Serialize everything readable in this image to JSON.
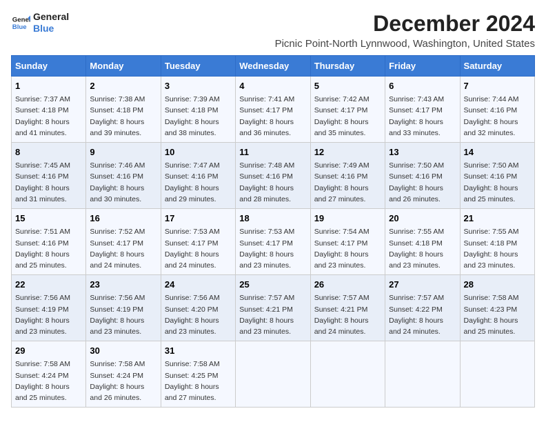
{
  "logo": {
    "line1": "General",
    "line2": "Blue"
  },
  "title": "December 2024",
  "subtitle": "Picnic Point-North Lynnwood, Washington, United States",
  "days_of_week": [
    "Sunday",
    "Monday",
    "Tuesday",
    "Wednesday",
    "Thursday",
    "Friday",
    "Saturday"
  ],
  "weeks": [
    [
      {
        "day": "1",
        "sunrise": "7:37 AM",
        "sunset": "4:18 PM",
        "daylight": "8 hours and 41 minutes."
      },
      {
        "day": "2",
        "sunrise": "7:38 AM",
        "sunset": "4:18 PM",
        "daylight": "8 hours and 39 minutes."
      },
      {
        "day": "3",
        "sunrise": "7:39 AM",
        "sunset": "4:18 PM",
        "daylight": "8 hours and 38 minutes."
      },
      {
        "day": "4",
        "sunrise": "7:41 AM",
        "sunset": "4:17 PM",
        "daylight": "8 hours and 36 minutes."
      },
      {
        "day": "5",
        "sunrise": "7:42 AM",
        "sunset": "4:17 PM",
        "daylight": "8 hours and 35 minutes."
      },
      {
        "day": "6",
        "sunrise": "7:43 AM",
        "sunset": "4:17 PM",
        "daylight": "8 hours and 33 minutes."
      },
      {
        "day": "7",
        "sunrise": "7:44 AM",
        "sunset": "4:16 PM",
        "daylight": "8 hours and 32 minutes."
      }
    ],
    [
      {
        "day": "8",
        "sunrise": "7:45 AM",
        "sunset": "4:16 PM",
        "daylight": "8 hours and 31 minutes."
      },
      {
        "day": "9",
        "sunrise": "7:46 AM",
        "sunset": "4:16 PM",
        "daylight": "8 hours and 30 minutes."
      },
      {
        "day": "10",
        "sunrise": "7:47 AM",
        "sunset": "4:16 PM",
        "daylight": "8 hours and 29 minutes."
      },
      {
        "day": "11",
        "sunrise": "7:48 AM",
        "sunset": "4:16 PM",
        "daylight": "8 hours and 28 minutes."
      },
      {
        "day": "12",
        "sunrise": "7:49 AM",
        "sunset": "4:16 PM",
        "daylight": "8 hours and 27 minutes."
      },
      {
        "day": "13",
        "sunrise": "7:50 AM",
        "sunset": "4:16 PM",
        "daylight": "8 hours and 26 minutes."
      },
      {
        "day": "14",
        "sunrise": "7:50 AM",
        "sunset": "4:16 PM",
        "daylight": "8 hours and 25 minutes."
      }
    ],
    [
      {
        "day": "15",
        "sunrise": "7:51 AM",
        "sunset": "4:16 PM",
        "daylight": "8 hours and 25 minutes."
      },
      {
        "day": "16",
        "sunrise": "7:52 AM",
        "sunset": "4:17 PM",
        "daylight": "8 hours and 24 minutes."
      },
      {
        "day": "17",
        "sunrise": "7:53 AM",
        "sunset": "4:17 PM",
        "daylight": "8 hours and 24 minutes."
      },
      {
        "day": "18",
        "sunrise": "7:53 AM",
        "sunset": "4:17 PM",
        "daylight": "8 hours and 23 minutes."
      },
      {
        "day": "19",
        "sunrise": "7:54 AM",
        "sunset": "4:17 PM",
        "daylight": "8 hours and 23 minutes."
      },
      {
        "day": "20",
        "sunrise": "7:55 AM",
        "sunset": "4:18 PM",
        "daylight": "8 hours and 23 minutes."
      },
      {
        "day": "21",
        "sunrise": "7:55 AM",
        "sunset": "4:18 PM",
        "daylight": "8 hours and 23 minutes."
      }
    ],
    [
      {
        "day": "22",
        "sunrise": "7:56 AM",
        "sunset": "4:19 PM",
        "daylight": "8 hours and 23 minutes."
      },
      {
        "day": "23",
        "sunrise": "7:56 AM",
        "sunset": "4:19 PM",
        "daylight": "8 hours and 23 minutes."
      },
      {
        "day": "24",
        "sunrise": "7:56 AM",
        "sunset": "4:20 PM",
        "daylight": "8 hours and 23 minutes."
      },
      {
        "day": "25",
        "sunrise": "7:57 AM",
        "sunset": "4:21 PM",
        "daylight": "8 hours and 23 minutes."
      },
      {
        "day": "26",
        "sunrise": "7:57 AM",
        "sunset": "4:21 PM",
        "daylight": "8 hours and 24 minutes."
      },
      {
        "day": "27",
        "sunrise": "7:57 AM",
        "sunset": "4:22 PM",
        "daylight": "8 hours and 24 minutes."
      },
      {
        "day": "28",
        "sunrise": "7:58 AM",
        "sunset": "4:23 PM",
        "daylight": "8 hours and 25 minutes."
      }
    ],
    [
      {
        "day": "29",
        "sunrise": "7:58 AM",
        "sunset": "4:24 PM",
        "daylight": "8 hours and 25 minutes."
      },
      {
        "day": "30",
        "sunrise": "7:58 AM",
        "sunset": "4:24 PM",
        "daylight": "8 hours and 26 minutes."
      },
      {
        "day": "31",
        "sunrise": "7:58 AM",
        "sunset": "4:25 PM",
        "daylight": "8 hours and 27 minutes."
      },
      null,
      null,
      null,
      null
    ]
  ],
  "labels": {
    "sunrise": "Sunrise:",
    "sunset": "Sunset:",
    "daylight": "Daylight:"
  }
}
